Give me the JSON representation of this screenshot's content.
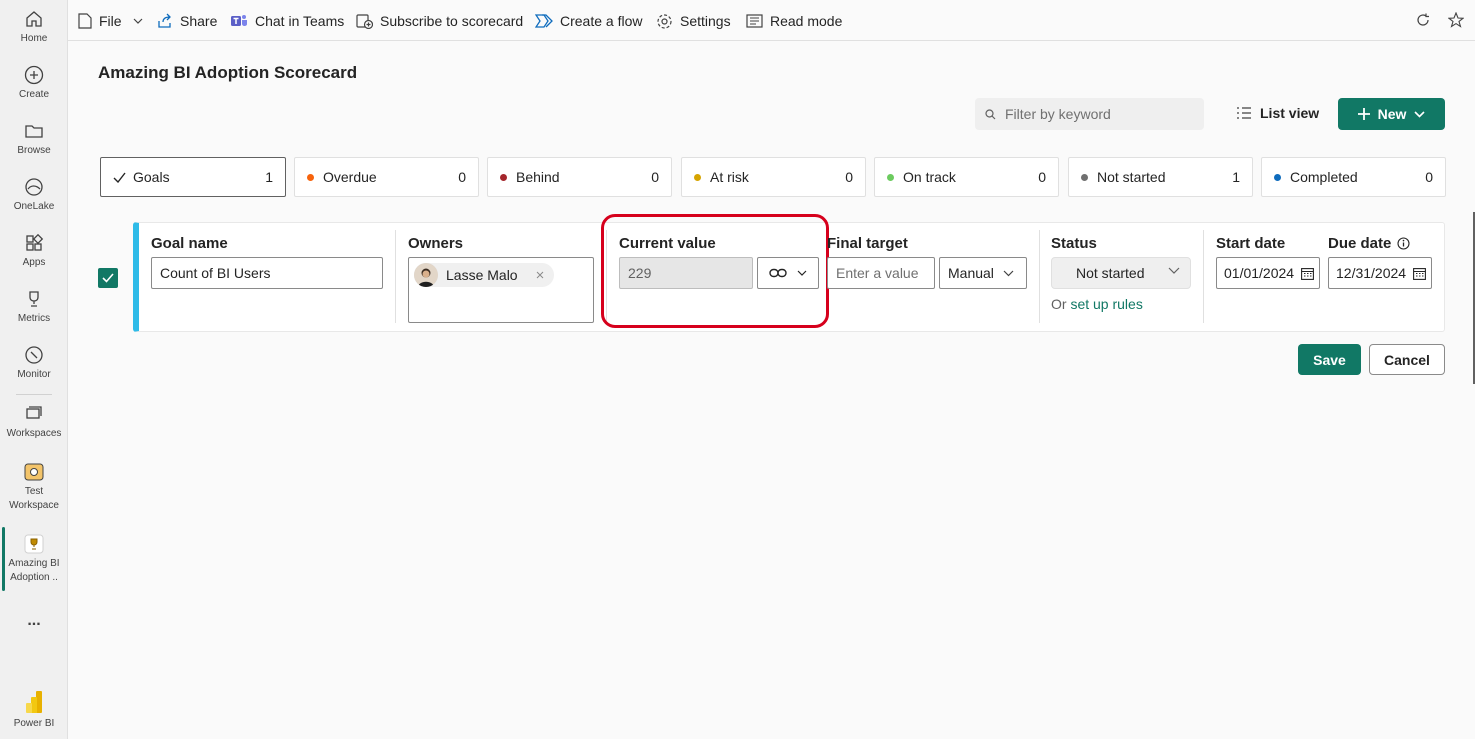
{
  "nav": {
    "home": "Home",
    "create": "Create",
    "browse": "Browse",
    "onelake": "OneLake",
    "apps": "Apps",
    "metrics": "Metrics",
    "monitor": "Monitor",
    "workspaces": "Workspaces",
    "test_workspace_1": "Test",
    "test_workspace_2": "Workspace",
    "scorecard_1": "Amazing BI",
    "scorecard_2": "Adoption ..",
    "more": "...",
    "powerbi": "Power BI"
  },
  "toolbar": {
    "file": "File",
    "share": "Share",
    "chat": "Chat in Teams",
    "subscribe": "Subscribe to scorecard",
    "flow": "Create a flow",
    "settings": "Settings",
    "read_mode": "Read mode"
  },
  "page": {
    "title": "Amazing BI Adoption Scorecard",
    "filter_placeholder": "Filter by keyword",
    "list_view": "List view",
    "new_label": "New"
  },
  "tiles": [
    {
      "label": "Goals",
      "count": "1",
      "color": ""
    },
    {
      "label": "Overdue",
      "count": "0",
      "color": "#f7630c"
    },
    {
      "label": "Behind",
      "count": "0",
      "color": "#a4262c"
    },
    {
      "label": "At risk",
      "count": "0",
      "color": "#d6a400"
    },
    {
      "label": "On track",
      "count": "0",
      "color": "#6ccb5f"
    },
    {
      "label": "Not started",
      "count": "1",
      "color": "#707070"
    },
    {
      "label": "Completed",
      "count": "0",
      "color": "#0f6cbd"
    }
  ],
  "goal": {
    "name_head": "Goal name",
    "name_value": "Count of BI Users",
    "owners_head": "Owners",
    "owner": "Lasse Malo",
    "current_head": "Current value",
    "current_value": "229",
    "target_head": "Final target",
    "target_placeholder": "Enter a value",
    "target_mode": "Manual",
    "status_head": "Status",
    "status_value": "Not started",
    "rules_prefix": "Or ",
    "rules_link": "set up rules",
    "start_head": "Start date",
    "start_value": "01/01/2024",
    "due_head": "Due date",
    "due_value": "12/31/2024"
  },
  "actions": {
    "save": "Save",
    "cancel": "Cancel"
  },
  "colors": {
    "accent": "#117865",
    "row_accent": "#2ebbe8",
    "highlight": "#d6001c"
  }
}
